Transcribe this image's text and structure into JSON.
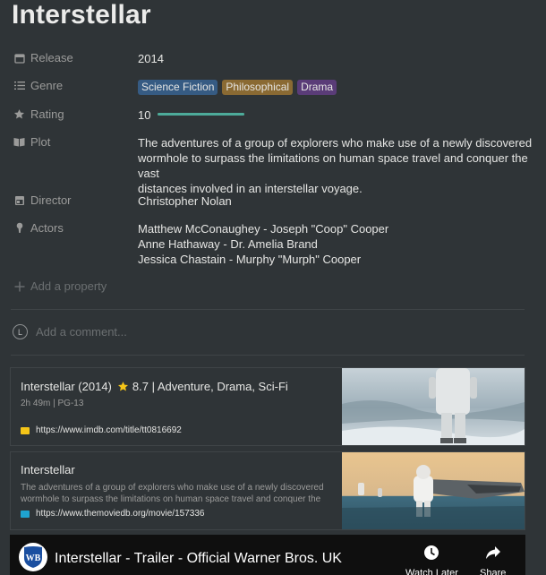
{
  "page": {
    "title": "Interstellar"
  },
  "properties": {
    "release": {
      "label": "Release",
      "value": "2014"
    },
    "genre": {
      "label": "Genre",
      "tags": [
        {
          "text": "Science Fiction",
          "color": "#365b83"
        },
        {
          "text": "Philosophical",
          "color": "#8a6a33"
        },
        {
          "text": "Drama",
          "color": "#5a3c78"
        }
      ]
    },
    "rating": {
      "label": "Rating",
      "value": "10",
      "fraction": 1.0
    },
    "plot": {
      "label": "Plot",
      "lines": [
        "The adventures of a group of explorers who make use of a newly discovered",
        "wormhole to surpass the limitations on human space travel and conquer the vast",
        "distances involved in an interstellar voyage."
      ]
    },
    "director": {
      "label": "Director",
      "value": "Christopher Nolan"
    },
    "actors": {
      "label": "Actors",
      "lines": [
        "Matthew McConaughey - Joseph \"Coop\" Cooper",
        "Anne Hathaway - Dr. Amelia Brand",
        "Jessica Chastain - Murphy \"Murph\" Cooper"
      ]
    },
    "add_property": "Add a property"
  },
  "comment": {
    "avatar_letter": "L",
    "placeholder": "Add a comment..."
  },
  "bookmarks": [
    {
      "title": "Interstellar (2014)",
      "star_icon": "star-icon",
      "rating": "8.7 | Adventure, Drama, Sci-Fi",
      "subtitle": "2h 49m | PG-13",
      "url": "https://www.imdb.com/title/tt0816692",
      "favicon_color": "#f5c518"
    },
    {
      "title": "Interstellar",
      "desc": "The adventures of a group of explorers who make use of a newly discovered wormhole to surpass the limitations on human space travel and conquer the vast",
      "url": "https://www.themoviedb.org/movie/157336",
      "favicon_color": "#1fa3d0"
    }
  ],
  "video": {
    "logo_text": "WB",
    "title": "Interstellar - Trailer - Official Warner Bros. UK",
    "watch_later": "Watch Later",
    "share": "Share"
  }
}
